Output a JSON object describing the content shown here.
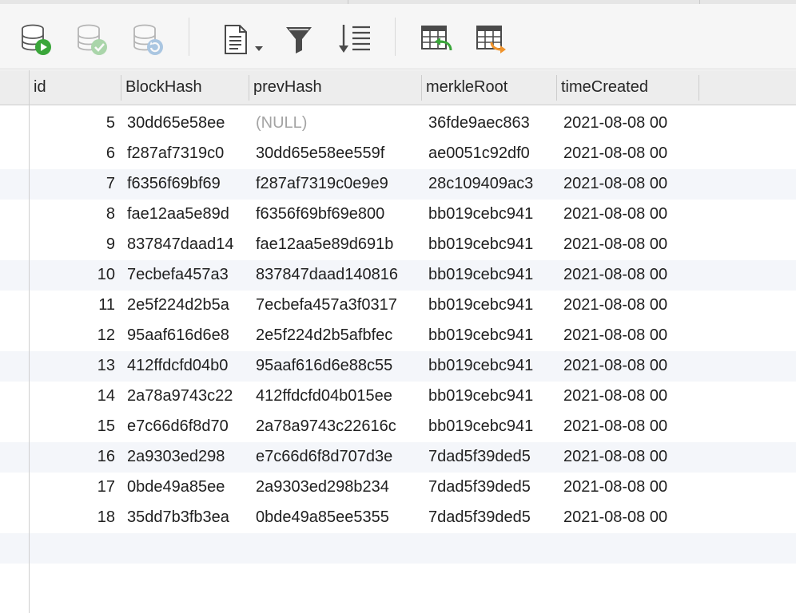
{
  "toolbar": {
    "buttons": [
      {
        "name": "run-query-button",
        "icon": "database-play-icon",
        "enabled": true
      },
      {
        "name": "commit-button",
        "icon": "database-check-icon",
        "enabled": false
      },
      {
        "name": "refresh-button",
        "icon": "database-refresh-icon",
        "enabled": false
      },
      {
        "name": "export-button",
        "icon": "document-dropdown-icon",
        "enabled": true
      },
      {
        "name": "filter-button",
        "icon": "filter-icon",
        "enabled": true
      },
      {
        "name": "sort-button",
        "icon": "sort-icon",
        "enabled": true
      },
      {
        "name": "import-table-button",
        "icon": "table-import-icon",
        "enabled": true
      },
      {
        "name": "export-table-button",
        "icon": "table-export-icon",
        "enabled": true
      }
    ]
  },
  "columns": [
    "id",
    "BlockHash",
    "prevHash",
    "merkleRoot",
    "timeCreated"
  ],
  "rows": [
    {
      "id": "5",
      "blockHash": "30dd65e58ee",
      "prevHash": "(NULL)",
      "merkleRoot": "36fde9aec863",
      "timeCreated": "2021-08-08 00"
    },
    {
      "id": "6",
      "blockHash": "f287af7319c0",
      "prevHash": "30dd65e58ee559f",
      "merkleRoot": "ae0051c92df0",
      "timeCreated": "2021-08-08 00"
    },
    {
      "id": "7",
      "blockHash": "f6356f69bf69",
      "prevHash": "f287af7319c0e9e9",
      "merkleRoot": "28c109409ac3",
      "timeCreated": "2021-08-08 00"
    },
    {
      "id": "8",
      "blockHash": "fae12aa5e89d",
      "prevHash": "f6356f69bf69e800",
      "merkleRoot": "bb019cebc941",
      "timeCreated": "2021-08-08 00"
    },
    {
      "id": "9",
      "blockHash": "837847daad14",
      "prevHash": "fae12aa5e89d691b",
      "merkleRoot": "bb019cebc941",
      "timeCreated": "2021-08-08 00"
    },
    {
      "id": "10",
      "blockHash": "7ecbefa457a3",
      "prevHash": "837847daad140816",
      "merkleRoot": "bb019cebc941",
      "timeCreated": "2021-08-08 00"
    },
    {
      "id": "11",
      "blockHash": "2e5f224d2b5a",
      "prevHash": "7ecbefa457a3f0317",
      "merkleRoot": "bb019cebc941",
      "timeCreated": "2021-08-08 00"
    },
    {
      "id": "12",
      "blockHash": "95aaf616d6e8",
      "prevHash": "2e5f224d2b5afbfec",
      "merkleRoot": "bb019cebc941",
      "timeCreated": "2021-08-08 00"
    },
    {
      "id": "13",
      "blockHash": "412ffdcfd04b0",
      "prevHash": "95aaf616d6e88c55",
      "merkleRoot": "bb019cebc941",
      "timeCreated": "2021-08-08 00"
    },
    {
      "id": "14",
      "blockHash": "2a78a9743c22",
      "prevHash": "412ffdcfd04b015ee",
      "merkleRoot": "bb019cebc941",
      "timeCreated": "2021-08-08 00"
    },
    {
      "id": "15",
      "blockHash": "e7c66d6f8d70",
      "prevHash": "2a78a9743c22616c",
      "merkleRoot": "bb019cebc941",
      "timeCreated": "2021-08-08 00"
    },
    {
      "id": "16",
      "blockHash": "2a9303ed298",
      "prevHash": "e7c66d6f8d707d3e",
      "merkleRoot": "7dad5f39ded5",
      "timeCreated": "2021-08-08 00"
    },
    {
      "id": "17",
      "blockHash": "0bde49a85ee",
      "prevHash": "2a9303ed298b234",
      "merkleRoot": "7dad5f39ded5",
      "timeCreated": "2021-08-08 00"
    },
    {
      "id": "18",
      "blockHash": "35dd7b3fb3ea",
      "prevHash": "0bde49a85ee5355",
      "merkleRoot": "7dad5f39ded5",
      "timeCreated": "2021-08-08 00"
    }
  ],
  "colors": {
    "accent_green": "#3aa63a",
    "accent_blue": "#3b7fc4",
    "accent_orange": "#f0932b",
    "alt_row": "#f4f6fa",
    "null_text": "#a4a4a4"
  }
}
